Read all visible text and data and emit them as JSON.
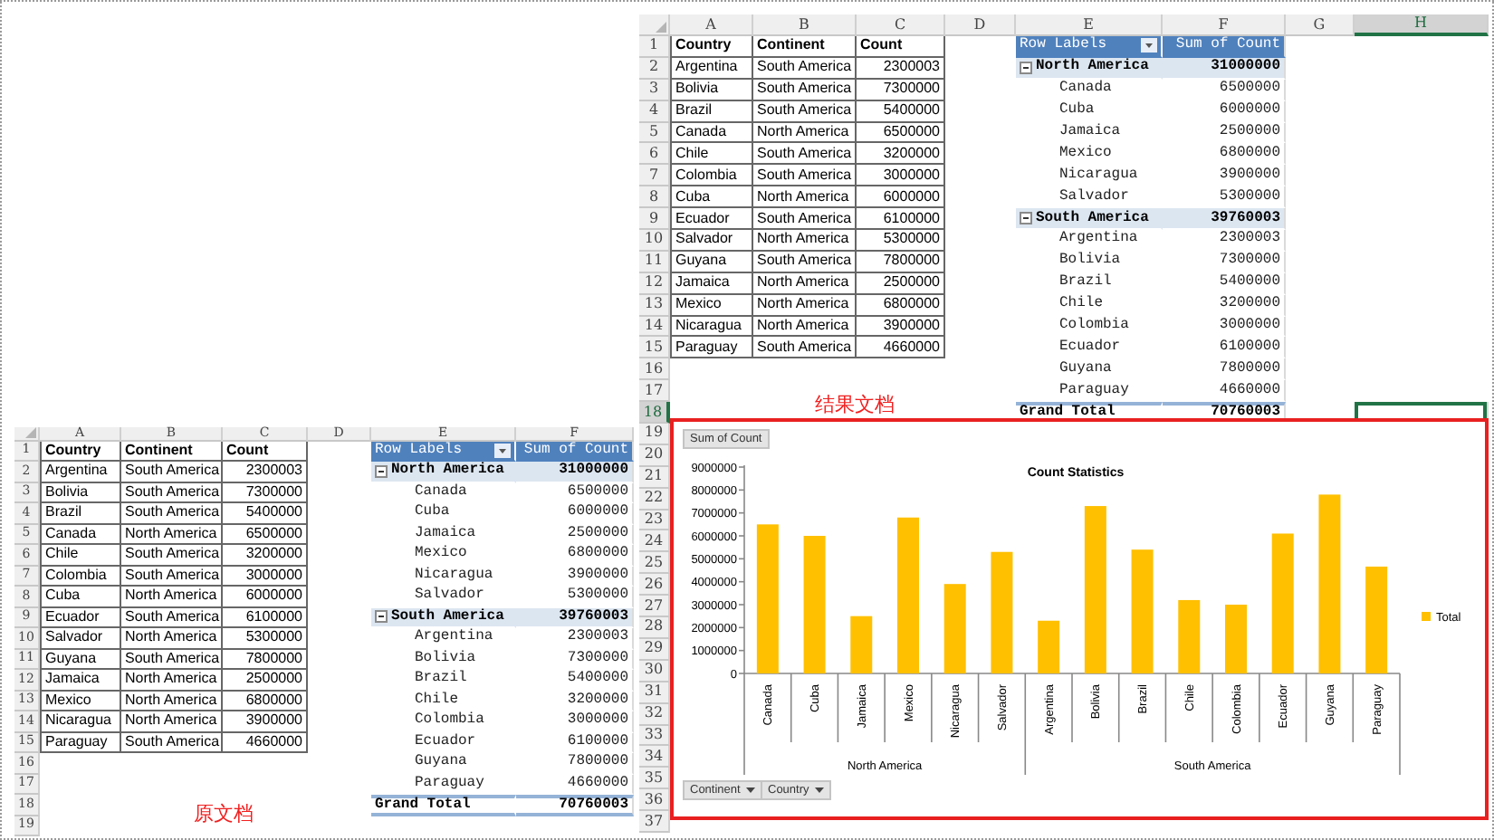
{
  "result_document": {
    "caption": "结果文档",
    "columns": [
      {
        "label": "A",
        "selected": false
      },
      {
        "label": "B",
        "selected": false
      },
      {
        "label": "C",
        "selected": false
      },
      {
        "label": "D",
        "selected": false
      },
      {
        "label": "E",
        "selected": false
      },
      {
        "label": "F",
        "selected": false
      },
      {
        "label": "G",
        "selected": false
      },
      {
        "label": "H",
        "selected": true
      }
    ],
    "row_numbers": [
      {
        "label": "1",
        "selected": false
      },
      {
        "label": "2",
        "selected": false
      },
      {
        "label": "3",
        "selected": false
      },
      {
        "label": "4",
        "selected": false
      },
      {
        "label": "5",
        "selected": false
      },
      {
        "label": "6",
        "selected": false
      },
      {
        "label": "7",
        "selected": false
      },
      {
        "label": "8",
        "selected": false
      },
      {
        "label": "9",
        "selected": false
      },
      {
        "label": "10",
        "selected": false
      },
      {
        "label": "11",
        "selected": false
      },
      {
        "label": "12",
        "selected": false
      },
      {
        "label": "13",
        "selected": false
      },
      {
        "label": "14",
        "selected": false
      },
      {
        "label": "15",
        "selected": false
      },
      {
        "label": "16",
        "selected": false
      },
      {
        "label": "17",
        "selected": false
      },
      {
        "label": "18",
        "selected": true
      },
      {
        "label": "19",
        "selected": false
      },
      {
        "label": "20",
        "selected": false
      },
      {
        "label": "21",
        "selected": false
      },
      {
        "label": "22",
        "selected": false
      },
      {
        "label": "23",
        "selected": false
      },
      {
        "label": "24",
        "selected": false
      },
      {
        "label": "25",
        "selected": false
      },
      {
        "label": "26",
        "selected": false
      },
      {
        "label": "27",
        "selected": false
      },
      {
        "label": "28",
        "selected": false
      },
      {
        "label": "29",
        "selected": false
      },
      {
        "label": "30",
        "selected": false
      },
      {
        "label": "31",
        "selected": false
      },
      {
        "label": "32",
        "selected": false
      },
      {
        "label": "33",
        "selected": false
      },
      {
        "label": "34",
        "selected": false
      },
      {
        "label": "35",
        "selected": false
      },
      {
        "label": "36",
        "selected": false
      },
      {
        "label": "37",
        "selected": false
      }
    ],
    "source_table": {
      "columns": [
        "Country",
        "Continent",
        "Count"
      ],
      "rows": [
        [
          "Argentina",
          "South America",
          "2300003"
        ],
        [
          "Bolivia",
          "South America",
          "7300000"
        ],
        [
          "Brazil",
          "South America",
          "5400000"
        ],
        [
          "Canada",
          "North America",
          "6500000"
        ],
        [
          "Chile",
          "South America",
          "3200000"
        ],
        [
          "Colombia",
          "South America",
          "3000000"
        ],
        [
          "Cuba",
          "North America",
          "6000000"
        ],
        [
          "Ecuador",
          "South America",
          "6100000"
        ],
        [
          "Salvador",
          "North America",
          "5300000"
        ],
        [
          "Guyana",
          "South America",
          "7800000"
        ],
        [
          "Jamaica",
          "North America",
          "2500000"
        ],
        [
          "Mexico",
          "North America",
          "6800000"
        ],
        [
          "Nicaragua",
          "North America",
          "3900000"
        ],
        [
          "Paraguay",
          "South America",
          "4660000"
        ]
      ]
    },
    "pivot": {
      "columns": [
        "Row Labels",
        "Sum of Count"
      ],
      "groups": [
        {
          "label": "North America",
          "total": "31000000",
          "expanded": true,
          "items": [
            {
              "label": "Canada",
              "value": "6500000"
            },
            {
              "label": "Cuba",
              "value": "6000000"
            },
            {
              "label": "Jamaica",
              "value": "2500000"
            },
            {
              "label": "Mexico",
              "value": "6800000"
            },
            {
              "label": "Nicaragua",
              "value": "3900000"
            },
            {
              "label": "Salvador",
              "value": "5300000"
            }
          ]
        },
        {
          "label": "South America",
          "total": "39760003",
          "expanded": true,
          "items": [
            {
              "label": "Argentina",
              "value": "2300003"
            },
            {
              "label": "Bolivia",
              "value": "7300000"
            },
            {
              "label": "Brazil",
              "value": "5400000"
            },
            {
              "label": "Chile",
              "value": "3200000"
            },
            {
              "label": "Colombia",
              "value": "3000000"
            },
            {
              "label": "Ecuador",
              "value": "6100000"
            },
            {
              "label": "Guyana",
              "value": "7800000"
            },
            {
              "label": "Paraguay",
              "value": "4660000"
            }
          ]
        }
      ],
      "grand_total": {
        "label": "Grand Total",
        "value": "70760003"
      }
    },
    "chart": {
      "value_button": "Sum of Count",
      "field_buttons": [
        "Continent",
        "Country"
      ],
      "category_groups": [
        "North America",
        "South America"
      ],
      "chart_data": {
        "type": "bar",
        "title": "Count Statistics",
        "categories": [
          "Canada",
          "Cuba",
          "Jamaica",
          "Mexico",
          "Nicaragua",
          "Salvador",
          "Argentina",
          "Bolivia",
          "Brazil",
          "Chile",
          "Colombia",
          "Ecuador",
          "Guyana",
          "Paraguay"
        ],
        "series": [
          {
            "name": "Total",
            "color": "#ffc000",
            "values": [
              6500000,
              6000000,
              2500000,
              6800000,
              3900000,
              5300000,
              2300000,
              7300000,
              5400000,
              3200000,
              3000000,
              6100000,
              7800000,
              4660000
            ]
          }
        ],
        "ylim": [
          0,
          9000000
        ],
        "yticks": [
          0,
          1000000,
          2000000,
          3000000,
          4000000,
          5000000,
          6000000,
          7000000,
          8000000,
          9000000
        ]
      }
    }
  },
  "original_document": {
    "caption": "原文档",
    "columns": [
      {
        "label": "A",
        "selected": false
      },
      {
        "label": "B",
        "selected": false
      },
      {
        "label": "C",
        "selected": false
      },
      {
        "label": "D",
        "selected": false
      },
      {
        "label": "E",
        "selected": false
      },
      {
        "label": "F",
        "selected": false
      }
    ],
    "row_numbers": [
      {
        "label": "1",
        "selected": false
      },
      {
        "label": "2",
        "selected": false
      },
      {
        "label": "3",
        "selected": false
      },
      {
        "label": "4",
        "selected": false
      },
      {
        "label": "5",
        "selected": false
      },
      {
        "label": "6",
        "selected": false
      },
      {
        "label": "7",
        "selected": false
      },
      {
        "label": "8",
        "selected": false
      },
      {
        "label": "9",
        "selected": false
      },
      {
        "label": "10",
        "selected": false
      },
      {
        "label": "11",
        "selected": false
      },
      {
        "label": "12",
        "selected": false
      },
      {
        "label": "13",
        "selected": false
      },
      {
        "label": "14",
        "selected": false
      },
      {
        "label": "15",
        "selected": false
      },
      {
        "label": "16",
        "selected": false
      },
      {
        "label": "17",
        "selected": false
      },
      {
        "label": "18",
        "selected": false
      },
      {
        "label": "19",
        "selected": false
      }
    ],
    "source_table": {
      "columns": [
        "Country",
        "Continent",
        "Count"
      ],
      "rows": [
        [
          "Argentina",
          "South America",
          "2300003"
        ],
        [
          "Bolivia",
          "South America",
          "7300000"
        ],
        [
          "Brazil",
          "South America",
          "5400000"
        ],
        [
          "Canada",
          "North America",
          "6500000"
        ],
        [
          "Chile",
          "South America",
          "3200000"
        ],
        [
          "Colombia",
          "South America",
          "3000000"
        ],
        [
          "Cuba",
          "North America",
          "6000000"
        ],
        [
          "Ecuador",
          "South America",
          "6100000"
        ],
        [
          "Salvador",
          "North America",
          "5300000"
        ],
        [
          "Guyana",
          "South America",
          "7800000"
        ],
        [
          "Jamaica",
          "North America",
          "2500000"
        ],
        [
          "Mexico",
          "North America",
          "6800000"
        ],
        [
          "Nicaragua",
          "North America",
          "3900000"
        ],
        [
          "Paraguay",
          "South America",
          "4660000"
        ]
      ]
    },
    "pivot": {
      "columns": [
        "Row Labels",
        "Sum of Count"
      ],
      "groups": [
        {
          "label": "North America",
          "total": "31000000",
          "expanded": true,
          "items": [
            {
              "label": "Canada",
              "value": "6500000"
            },
            {
              "label": "Cuba",
              "value": "6000000"
            },
            {
              "label": "Jamaica",
              "value": "2500000"
            },
            {
              "label": "Mexico",
              "value": "6800000"
            },
            {
              "label": "Nicaragua",
              "value": "3900000"
            },
            {
              "label": "Salvador",
              "value": "5300000"
            }
          ]
        },
        {
          "label": "South America",
          "total": "39760003",
          "expanded": true,
          "items": [
            {
              "label": "Argentina",
              "value": "2300003"
            },
            {
              "label": "Bolivia",
              "value": "7300000"
            },
            {
              "label": "Brazil",
              "value": "5400000"
            },
            {
              "label": "Chile",
              "value": "3200000"
            },
            {
              "label": "Colombia",
              "value": "3000000"
            },
            {
              "label": "Ecuador",
              "value": "6100000"
            },
            {
              "label": "Guyana",
              "value": "7800000"
            },
            {
              "label": "Paraguay",
              "value": "4660000"
            }
          ]
        }
      ],
      "grand_total": {
        "label": "Grand Total",
        "value": "70760003"
      }
    }
  }
}
